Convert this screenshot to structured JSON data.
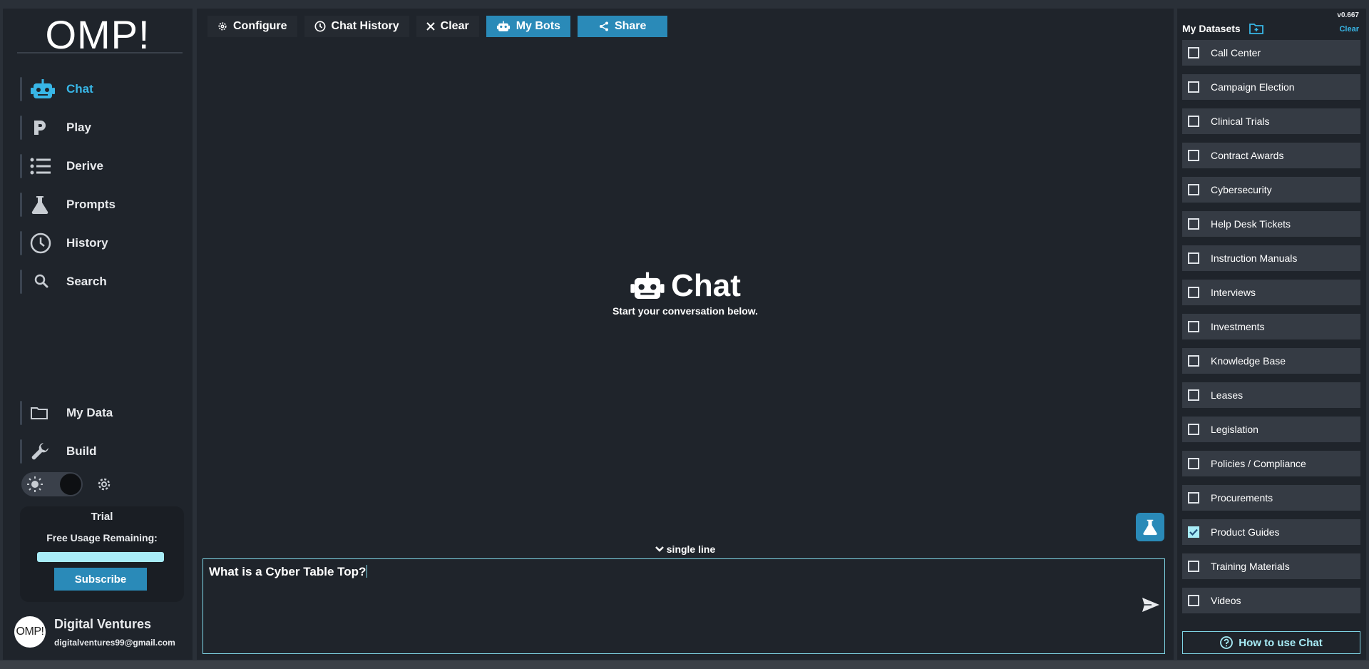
{
  "app": {
    "logo": "OMP!",
    "version": "v0.667"
  },
  "sidebar": {
    "nav": [
      {
        "label": "Chat",
        "icon": "robot-icon",
        "active": true
      },
      {
        "label": "Play",
        "icon": "play-p-icon"
      },
      {
        "label": "Derive",
        "icon": "list-icon"
      },
      {
        "label": "Prompts",
        "icon": "flask-icon"
      },
      {
        "label": "History",
        "icon": "clock-icon"
      },
      {
        "label": "Search",
        "icon": "search-icon"
      }
    ],
    "bottom_nav": [
      {
        "label": "My Data",
        "icon": "folder-icon"
      },
      {
        "label": "Build",
        "icon": "wrench-icon"
      }
    ],
    "trial": {
      "title": "Trial",
      "usage_label": "Free Usage Remaining:",
      "usage_fraction": 1.0,
      "subscribe_label": "Subscribe"
    },
    "user": {
      "avatar_text": "OMP!",
      "name": "Digital Ventures",
      "email": "digitalventures99@gmail.com"
    }
  },
  "toolbar": {
    "configure": "Configure",
    "chat_history": "Chat History",
    "clear": "Clear",
    "my_bots": "My Bots",
    "share": "Share"
  },
  "main": {
    "hero_title": "Chat",
    "hero_subtitle": "Start your conversation below.",
    "mode_toggle": "single line",
    "input_value": "What is a Cyber Table Top?"
  },
  "datasets": {
    "header": "My Datasets",
    "clear_label": "Clear",
    "items": [
      {
        "name": "Call Center",
        "checked": false
      },
      {
        "name": "Campaign Election",
        "checked": false
      },
      {
        "name": "Clinical Trials",
        "checked": false
      },
      {
        "name": "Contract Awards",
        "checked": false
      },
      {
        "name": "Cybersecurity",
        "checked": false
      },
      {
        "name": "Help Desk Tickets",
        "checked": false
      },
      {
        "name": "Instruction Manuals",
        "checked": false
      },
      {
        "name": "Interviews",
        "checked": false
      },
      {
        "name": "Investments",
        "checked": false
      },
      {
        "name": "Knowledge Base",
        "checked": false
      },
      {
        "name": "Leases",
        "checked": false
      },
      {
        "name": "Legislation",
        "checked": false
      },
      {
        "name": "Policies / Compliance",
        "checked": false
      },
      {
        "name": "Procurements",
        "checked": false
      },
      {
        "name": "Product Guides",
        "checked": true
      },
      {
        "name": "Training Materials",
        "checked": false
      },
      {
        "name": "Videos",
        "checked": false
      }
    ],
    "howto_label": "How to use Chat"
  },
  "colors": {
    "accent": "#2a8ab8",
    "active_text": "#38b6e6",
    "highlight": "#a8ecf7",
    "panel_bg": "#1f242b",
    "page_bg": "#2a3038"
  }
}
